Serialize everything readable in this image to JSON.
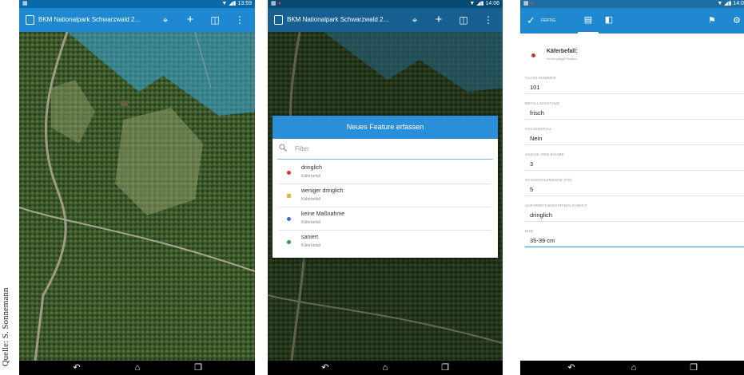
{
  "credit": "Quelle: S. Sonnemann",
  "screen1": {
    "status": {
      "time": "13:59",
      "icons": "▼ ◢▮"
    },
    "appbar": {
      "title": "BKM Nationalpark Schwarzwald 2..."
    },
    "icons": [
      "app-icon",
      "locate-icon",
      "add-icon",
      "layers-icon",
      "overflow-menu-icon"
    ],
    "nav": {
      "back": "↶",
      "home": "⌂",
      "recents": "❐"
    }
  },
  "screen2": {
    "status": {
      "time": "14:06",
      "icons": "▼ ◢▮"
    },
    "appbar": {
      "title": "BKM Nationalpark Schwarzwald 2..."
    },
    "dialog": {
      "title": "Neues Feature erfassen",
      "filter_placeholder": "Filter",
      "items": [
        {
          "name": "dringlich",
          "sub": "Käferbefall",
          "color": "#d0372e"
        },
        {
          "name": "weniger dringlich",
          "sub": "Käferbefall",
          "color": "#e3b43a"
        },
        {
          "name": "keine Maßnahme",
          "sub": "Käferbefall",
          "color": "#3a6ed8"
        },
        {
          "name": "saniert",
          "sub": "Käferbefall",
          "color": "#2e9e44"
        }
      ]
    }
  },
  "screen3": {
    "status": {
      "time": "14:0",
      "icons": "▼ ◢▮"
    },
    "toolbar": {
      "done_label": "FERTIG"
    },
    "header": {
      "title": "Käferbefall:",
      "subtitle": "Keine gültige Position",
      "dot_color": "#c0392b"
    },
    "fields": [
      {
        "label": "CLASS-NUMMER",
        "value": "101"
      },
      {
        "label": "BEFALLSZUSTAND",
        "value": "frisch"
      },
      {
        "label": "FOLGEBEFALL",
        "value": "Nein"
      },
      {
        "label": "ANZAHL DER BÄUME",
        "value": "3"
      },
      {
        "label": "SCHADHOLZMENGE (FM)",
        "value": "5"
      },
      {
        "label": "AUFARBEITUNGSDRINGLICHKEIT",
        "value": "dringlich"
      },
      {
        "label": "BHD",
        "value": "35-39 cm"
      }
    ]
  },
  "colors": {
    "appbar": "#1e88d0",
    "statusbar": "#0a6aa8",
    "accent": "#2a8fd8"
  }
}
